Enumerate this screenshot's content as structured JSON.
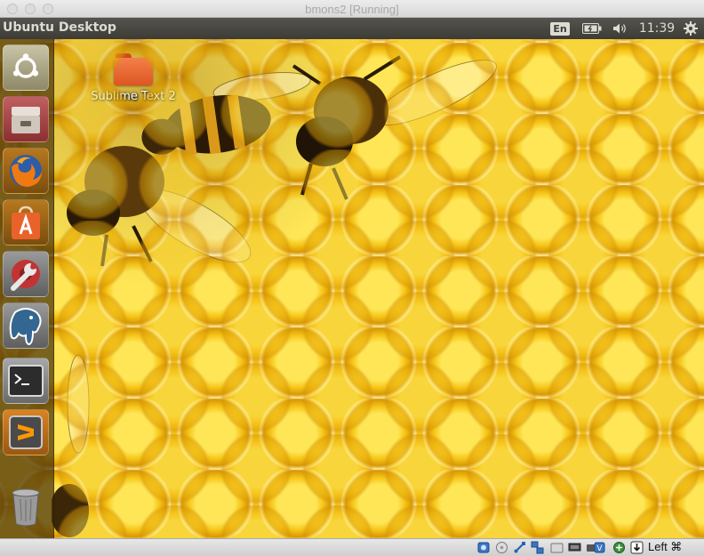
{
  "window": {
    "title": "bmons2 [Running]"
  },
  "panel": {
    "title": "Ubuntu Desktop",
    "language": "En",
    "clock": "11:39",
    "icons": [
      "battery-icon",
      "volume-icon",
      "gear-icon"
    ]
  },
  "desktop": {
    "icons": [
      {
        "label": "Sublime Text 2",
        "icon": "folder-icon"
      }
    ],
    "wallpaper": "honeycomb-bees"
  },
  "launcher": {
    "items": [
      {
        "name": "ubuntu-dash",
        "icon": "ubuntu-logo-icon",
        "color": "#b5b092"
      },
      {
        "name": "files",
        "icon": "file-cabinet-icon",
        "color": "#b14a4a"
      },
      {
        "name": "firefox",
        "icon": "firefox-icon",
        "color": "#e66000"
      },
      {
        "name": "software-center",
        "icon": "shopping-bag-icon",
        "color": "#e9622a"
      },
      {
        "name": "system-settings",
        "icon": "wrench-gear-icon",
        "color": "#a83232"
      },
      {
        "name": "pgadmin",
        "icon": "elephant-icon",
        "color": "#336791"
      },
      {
        "name": "terminal",
        "icon": "terminal-icon",
        "color": "#2c2c2c"
      },
      {
        "name": "sublime-text",
        "icon": "sublime-icon",
        "color": "#d98323"
      },
      {
        "name": "trash",
        "icon": "trash-icon",
        "color": "#8f8f8f"
      }
    ]
  },
  "status_bar": {
    "host_key": "Left ⌘",
    "icons": [
      "hard-disk-icon",
      "optical-drive-icon",
      "usb-icon",
      "network-icon",
      "shared-folder-icon",
      "display-icon",
      "video-capture-icon",
      "cpu-icon",
      "mouse-integration-icon",
      "keyboard-capture-icon"
    ]
  },
  "colors": {
    "panel": "#3c3b37",
    "panel_text": "#dfdbd2",
    "honey": "#f2c21a",
    "launcher": "#46300a"
  }
}
